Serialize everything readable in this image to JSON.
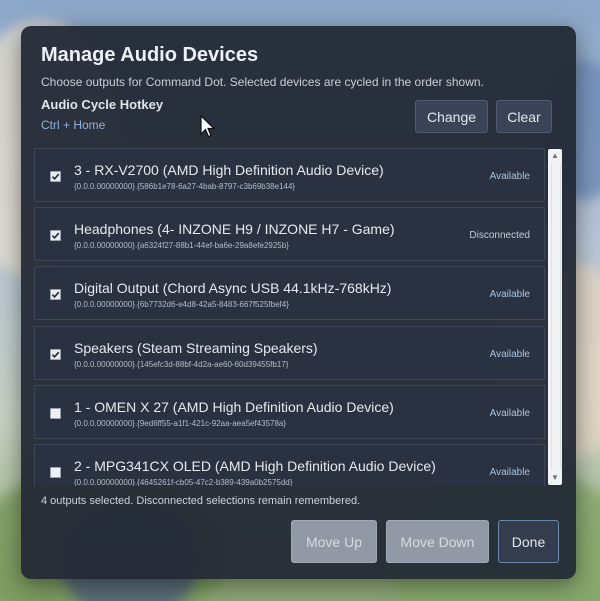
{
  "dialog": {
    "title": "Manage Audio Devices",
    "subtitle": "Choose outputs for Command Dot. Selected devices are cycled in the order shown.",
    "hotkey_label": "Audio Cycle Hotkey",
    "hotkey_value": "Ctrl + Home",
    "change_label": "Change",
    "clear_label": "Clear"
  },
  "devices": [
    {
      "name": "3 - RX-V2700 (AMD High Definition Audio Device)",
      "guid": "{0.0.0.00000000}.{586b1e78-6a27-4bab-8797-c3b69b38e144}",
      "status": "Available",
      "checked": true
    },
    {
      "name": "Headphones (4- INZONE H9 / INZONE H7 - Game)",
      "guid": "{0.0.0.00000000}.{a6324f27-88b1-44ef-ba6e-29a8efe2925b}",
      "status": "Disconnected",
      "checked": true
    },
    {
      "name": "Digital Output (Chord Async USB 44.1kHz-768kHz)",
      "guid": "{0.0.0.00000000}.{6b7732d6-e4d8-42a5-8483-667f525fbef4}",
      "status": "Available",
      "checked": true
    },
    {
      "name": "Speakers (Steam Streaming Speakers)",
      "guid": "{0.0.0.00000000}.{145efc3d-88bf-4d2a-ae60-60d39455fb17}",
      "status": "Available",
      "checked": true
    },
    {
      "name": "1 - OMEN X 27 (AMD High Definition Audio Device)",
      "guid": "{0.0.0.00000000}.{9ed6ff55-a1f1-421c-92aa-aea5ef43578a}",
      "status": "Available",
      "checked": false
    },
    {
      "name": "2 - MPG341CX OLED (AMD High Definition Audio Device)",
      "guid": "{0.0.0.00000000}.{4645261f-cb05-47c2-b389-439a0b2575dd}",
      "status": "Available",
      "checked": false
    }
  ],
  "footer": {
    "summary": "4 outputs selected. Disconnected selections remain remembered.",
    "move_up_label": "Move Up",
    "move_down_label": "Move Down",
    "done_label": "Done"
  },
  "icons": {
    "checkmark": "check-icon",
    "scroll_up": "chevron-up-icon",
    "scroll_down": "chevron-down-icon",
    "cursor": "mouse-pointer-icon"
  },
  "colors": {
    "dialog_bg": "#232935",
    "accent_status": "#a8c3e2",
    "hotkey": "#8fb2d8",
    "disabled_button": "#9199a6"
  }
}
